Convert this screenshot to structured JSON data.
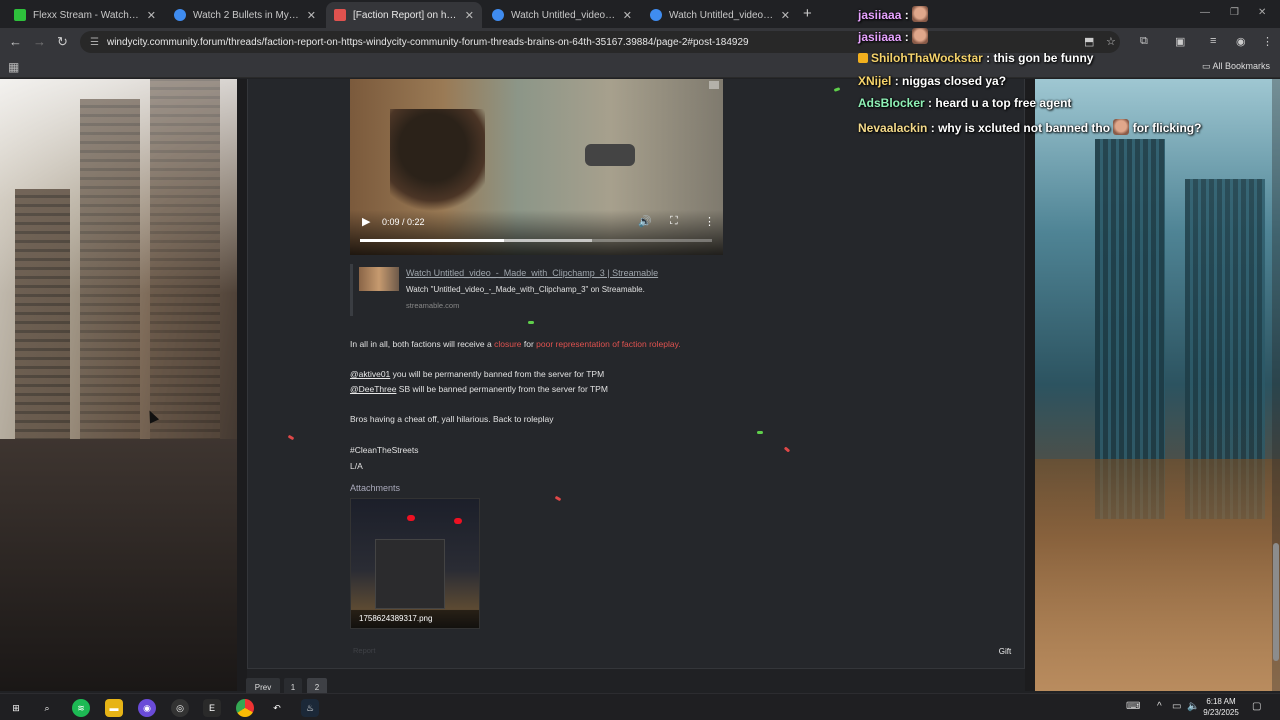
{
  "browser": {
    "tabs": [
      {
        "title": "Flexx Stream - Watch Live on K",
        "fav_color": "#2ec13c",
        "active": false
      },
      {
        "title": "Watch 2 Bullets in My Yawk",
        "fav_color": "#3f8cf0",
        "active": false
      },
      {
        "title": "[Faction Report] on https://win",
        "fav_color": "#e0524f",
        "active": true
      },
      {
        "title": "Watch Untitled_video_-_Made_",
        "fav_color": "#3f8cf0",
        "active": false
      },
      {
        "title": "Watch Untitled_video_-_Made_",
        "fav_color": "#3f8cf0",
        "active": false
      }
    ],
    "url": "windycity.community.forum/threads/faction-report-on-https-windycity-community-forum-threads-brains-on-64th-35167.39884/page-2#post-184929",
    "bookmarks_label": "All Bookmarks"
  },
  "video": {
    "time": "0:09 / 0:22",
    "progress": 0.41,
    "buffered": 0.66
  },
  "embed": {
    "title": "Watch Untitled_video_-_Made_with_Clipchamp_3 | Streamable",
    "description": "Watch \"Untitled_video_-_Made_with_Clipchamp_3\" on Streamable.",
    "domain": "streamable.com"
  },
  "post": {
    "line1_pre": "In all in all, both factions will receive a ",
    "line1_closure": "closure",
    "line1_mid": " for ",
    "line1_reason": "poor representation of faction roleplay.",
    "mention1": "@aktive01",
    "line2_rest": " you will be permanently banned from the server for TPM",
    "mention2": "@DeeThree",
    "line3_rest": " SB will be banned permanently from the server for TPM",
    "line4": "Bros having a cheat off, yall hilarious. Back to roleplay",
    "line5": "#CleanTheStreets",
    "line6": "L/A",
    "attachments_label": "Attachments",
    "attachment_file": "1758624389317.png",
    "report_label": "Report",
    "gift_label": "Gift"
  },
  "pagination": {
    "prev": "Prev",
    "pages": [
      "1",
      "2"
    ],
    "current": "2"
  },
  "chat": [
    {
      "nick": "jasiiaaa",
      "color": "#e7a3ff",
      "text": "",
      "emote": true,
      "badge": false
    },
    {
      "nick": "jasiiaaa",
      "color": "#e7a3ff",
      "text": "",
      "emote": true,
      "badge": false
    },
    {
      "nick": "ShilohThaWockstar",
      "color": "#f5d36b",
      "text": "this gon be funny",
      "emote": false,
      "badge": true
    },
    {
      "nick": "XNijel",
      "color": "#f5d36b",
      "text": "niggas closed ya?",
      "emote": false,
      "badge": false
    },
    {
      "nick": "AdsBlocker",
      "color": "#8ef0b5",
      "text": "heard u a top free agent",
      "emote": false,
      "badge": false
    },
    {
      "nick": "Nevaalackin",
      "color": "#f3d98a",
      "text": "why is xcluted not banned tho",
      "text2": "for flicking?",
      "emote": true,
      "badge": false
    }
  ],
  "taskbar": {
    "time": "6:18 AM",
    "date": "9/23/2025"
  }
}
